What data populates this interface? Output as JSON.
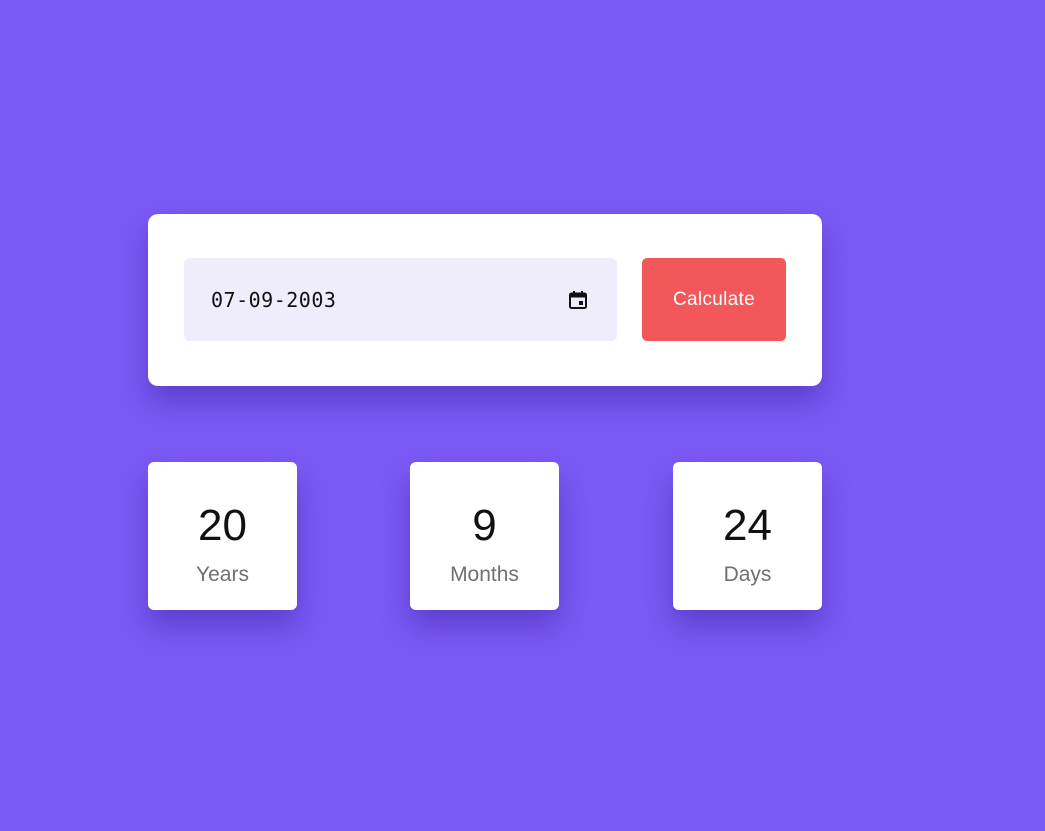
{
  "colors": {
    "background": "#7b59f4",
    "card": "#ffffff",
    "input_background": "#efedfc",
    "button": "#f2585a",
    "number_text": "#111111",
    "label_text": "#707070"
  },
  "form": {
    "date_value": "07-09-2003",
    "calendar_icon": "calendar-icon",
    "button_label": "Calculate"
  },
  "results": {
    "years": {
      "value": "20",
      "label": "Years"
    },
    "months": {
      "value": "9",
      "label": "Months"
    },
    "days": {
      "value": "24",
      "label": "Days"
    }
  }
}
